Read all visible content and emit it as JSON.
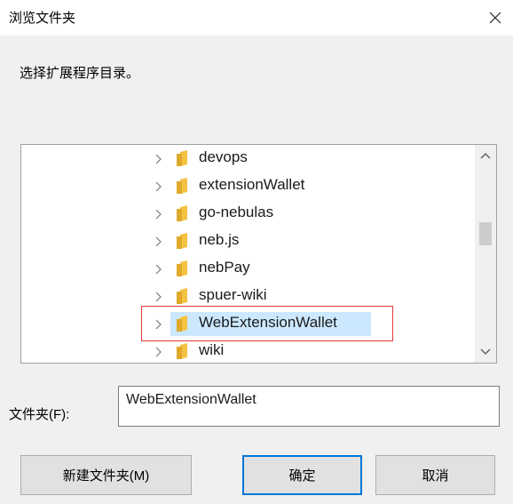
{
  "window": {
    "title": "浏览文件夹"
  },
  "dialog": {
    "prompt": "选择扩展程序目录。"
  },
  "tree": {
    "items": [
      {
        "label": "devops",
        "selected": false
      },
      {
        "label": "extensionWallet",
        "selected": false
      },
      {
        "label": "go-nebulas",
        "selected": false
      },
      {
        "label": "neb.js",
        "selected": false
      },
      {
        "label": "nebPay",
        "selected": false
      },
      {
        "label": "spuer-wiki",
        "selected": false
      },
      {
        "label": "WebExtensionWallet",
        "selected": true
      },
      {
        "label": "wiki",
        "selected": false
      }
    ]
  },
  "folder_field": {
    "label": "文件夹(F):",
    "value": "WebExtensionWallet"
  },
  "buttons": {
    "new_folder": "新建文件夹(M)",
    "ok": "确定",
    "cancel": "取消"
  },
  "colors": {
    "selection": "#cce8ff",
    "highlight_box": "#e03a3a",
    "primary_border": "#0078d7",
    "folder": "#f5c342"
  }
}
